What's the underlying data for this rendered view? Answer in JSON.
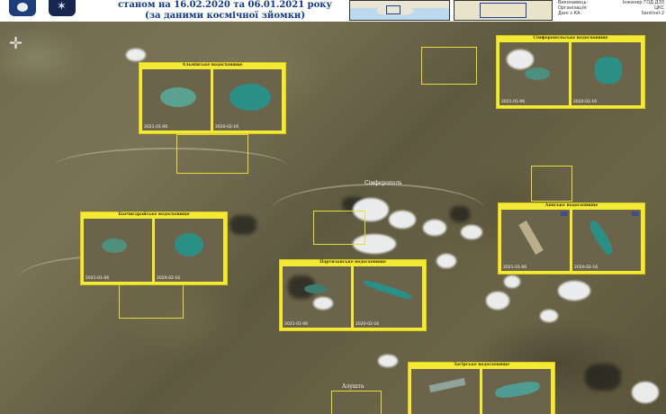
{
  "header": {
    "title_line1": "станом на 16.02.2020 та 06.01.2021 року",
    "title_line2": "(за даними космічної зйомки)",
    "legend": [
      {
        "label": "Виконавець:",
        "value": "Інженер ГОД ДЗЗ"
      },
      {
        "label": "Організація:",
        "value": "ЦКС"
      },
      {
        "label": "Дані з КА:",
        "value": "Sentinel-2"
      }
    ]
  },
  "panels": {
    "alminske": {
      "title": "Альмінське водосховище",
      "date_left": "2021-01-06",
      "date_right": "2020-02-16"
    },
    "simferopolske": {
      "title": "Сімферопольське водосховище",
      "date_left": "2021-01-06",
      "date_right": "2020-02-16"
    },
    "bakhchysaraiske": {
      "title": "Бахчисарайське водосховище",
      "date_left": "2021-01-06",
      "date_right": "2020-02-16"
    },
    "aianske": {
      "title": "Аянське водосховище",
      "date_left": "2021-01-06",
      "date_right": "2020-02-16"
    },
    "partyzanske": {
      "title": "Партизанське водосховище",
      "date_left": "2021-01-06",
      "date_right": "2020-02-16"
    },
    "zahirske": {
      "title": "Загірське водосховище"
    }
  },
  "places": {
    "simferopol": "Сімферополь",
    "alushta": "Алушта"
  },
  "colors": {
    "panel_bg": "#f4ea35",
    "lake": "#2c8f86",
    "title": "#123a8a"
  }
}
